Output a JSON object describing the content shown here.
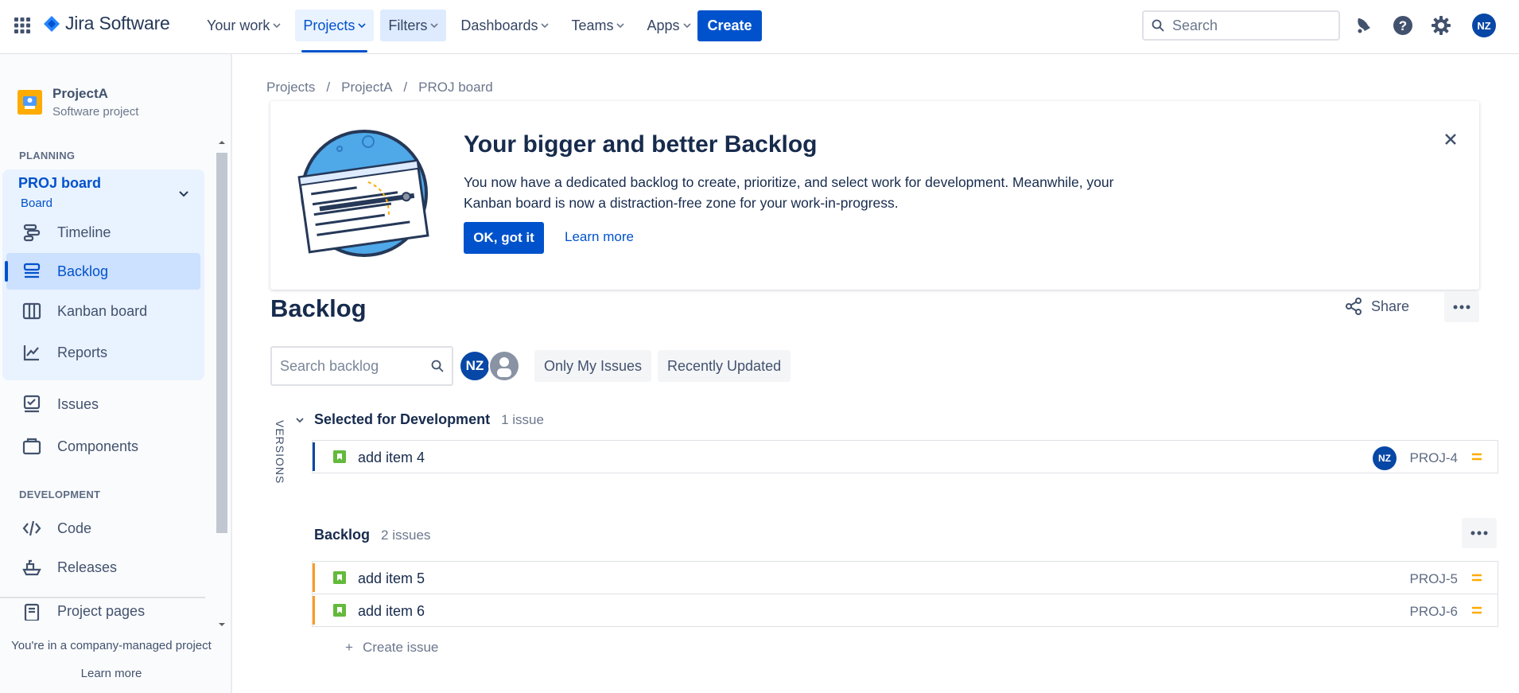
{
  "colors": {
    "brand": "#0052CC",
    "story_green": "#63BA3C",
    "priority_medium": "#FFAB00",
    "sprint_edge": "#0747A6",
    "backlog_edge": "#FF991F"
  },
  "topnav": {
    "logo_text": "Jira Software",
    "items": [
      {
        "label": "Your work"
      },
      {
        "label": "Projects"
      },
      {
        "label": "Filters"
      },
      {
        "label": "Dashboards"
      },
      {
        "label": "Teams"
      },
      {
        "label": "Apps"
      }
    ],
    "create_label": "Create",
    "search_placeholder": "Search",
    "user_initials": "NZ"
  },
  "sidebar": {
    "project_name": "ProjectA",
    "project_type": "Software project",
    "planning_label": "PLANNING",
    "board_title": "PROJ board",
    "board_sub": "Board",
    "planning_items": [
      {
        "label": "Timeline",
        "icon": "timeline-icon"
      },
      {
        "label": "Backlog",
        "icon": "backlog-icon"
      },
      {
        "label": "Kanban board",
        "icon": "kanban-board-icon"
      },
      {
        "label": "Reports",
        "icon": "reports-icon"
      }
    ],
    "other_items": [
      {
        "label": "Issues",
        "icon": "issues-icon"
      },
      {
        "label": "Components",
        "icon": "components-icon"
      }
    ],
    "development_label": "DEVELOPMENT",
    "development_items": [
      {
        "label": "Code",
        "icon": "code-icon"
      },
      {
        "label": "Releases",
        "icon": "releases-icon"
      },
      {
        "label": "Project pages",
        "icon": "project-pages-icon"
      }
    ],
    "footer_text": "You're in a company-managed project",
    "footer_link": "Learn more"
  },
  "breadcrumb": [
    "Projects",
    "/",
    "ProjectA",
    "/",
    "PROJ board"
  ],
  "banner": {
    "title": "Your bigger and better Backlog",
    "text": "You now have a dedicated backlog to create, prioritize, and select work for development. Meanwhile, your Kanban board is now a distraction-free zone for your work-in-progress.",
    "ok_label": "OK, got it",
    "learn_more": "Learn more"
  },
  "page": {
    "title": "Backlog",
    "share_label": "Share",
    "search_placeholder": "Search backlog",
    "assignee_initials": "NZ",
    "filters": [
      "Only My Issues",
      "Recently Updated"
    ],
    "versions_label": "VERSIONS"
  },
  "sprint": {
    "name": "Selected for Development",
    "count": "1 issue",
    "issues": [
      {
        "summary": "add item 4",
        "key": "PROJ-4",
        "assignee": "NZ"
      }
    ]
  },
  "backlog": {
    "name": "Backlog",
    "count": "2 issues",
    "issues": [
      {
        "summary": "add item 5",
        "key": "PROJ-5"
      },
      {
        "summary": "add item 6",
        "key": "PROJ-6"
      }
    ],
    "create_issue": "Create issue"
  }
}
